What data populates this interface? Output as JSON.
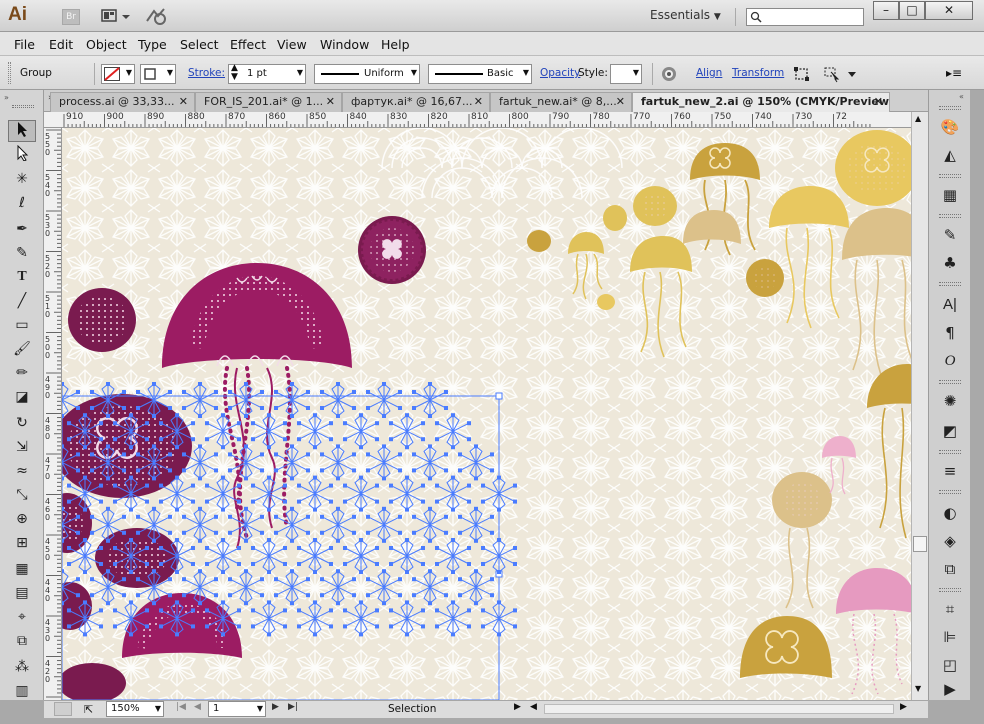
{
  "app": {
    "logo": "Ai",
    "bridge_label": "Br",
    "workspace": "Essentials",
    "search_placeholder": ""
  },
  "window_controls": [
    "–",
    "□",
    "✕"
  ],
  "menu": [
    "File",
    "Edit",
    "Object",
    "Type",
    "Select",
    "Effect",
    "View",
    "Window",
    "Help"
  ],
  "control_bar": {
    "selection_type": "Group",
    "stroke_label": "Stroke:",
    "stroke_weight": "1 pt",
    "profile": "Uniform",
    "brush": "Basic",
    "opacity_label": "Opacity",
    "style_label": "Style:",
    "align_label": "Align",
    "transform_label": "Transform"
  },
  "tabs": [
    {
      "label": "process.ai @ 33,33..."
    },
    {
      "label": "FOR_IS_201.ai* @ 1..."
    },
    {
      "label": "фартук.ai* @ 16,67..."
    },
    {
      "label": "fartuk_new.ai* @ 8,..."
    },
    {
      "label": "fartuk_new_2.ai @ 150% (CMYK/Preview)"
    }
  ],
  "ruler": {
    "h_ticks": [
      "910",
      "900",
      "890",
      "880",
      "870",
      "860",
      "850",
      "840",
      "830",
      "820",
      "810",
      "800",
      "790",
      "780",
      "770",
      "760",
      "750",
      "740",
      "730",
      "72"
    ],
    "v_ticks": [
      "5 5 0",
      "5 4 0",
      "5 3 0",
      "5 2 0",
      "5 1 0",
      "5 0 0",
      "4 9 0",
      "4 8 0",
      "4 7 0",
      "4 6 0",
      "4 5 0",
      "4 4 0",
      "4 3 0",
      "4 2 0",
      "4 1 0"
    ]
  },
  "status_bar": {
    "zoom": "150%",
    "page": "1",
    "mode": "Selection"
  },
  "colors": {
    "canvas_bg": "#eee8da",
    "magenta": "#9c1c63",
    "plum": "#7a1b4f",
    "gold": "#c9a23e",
    "gold_light": "#e0c25a",
    "pink": "#e69ac0",
    "selection_blue": "#4a7cff"
  }
}
